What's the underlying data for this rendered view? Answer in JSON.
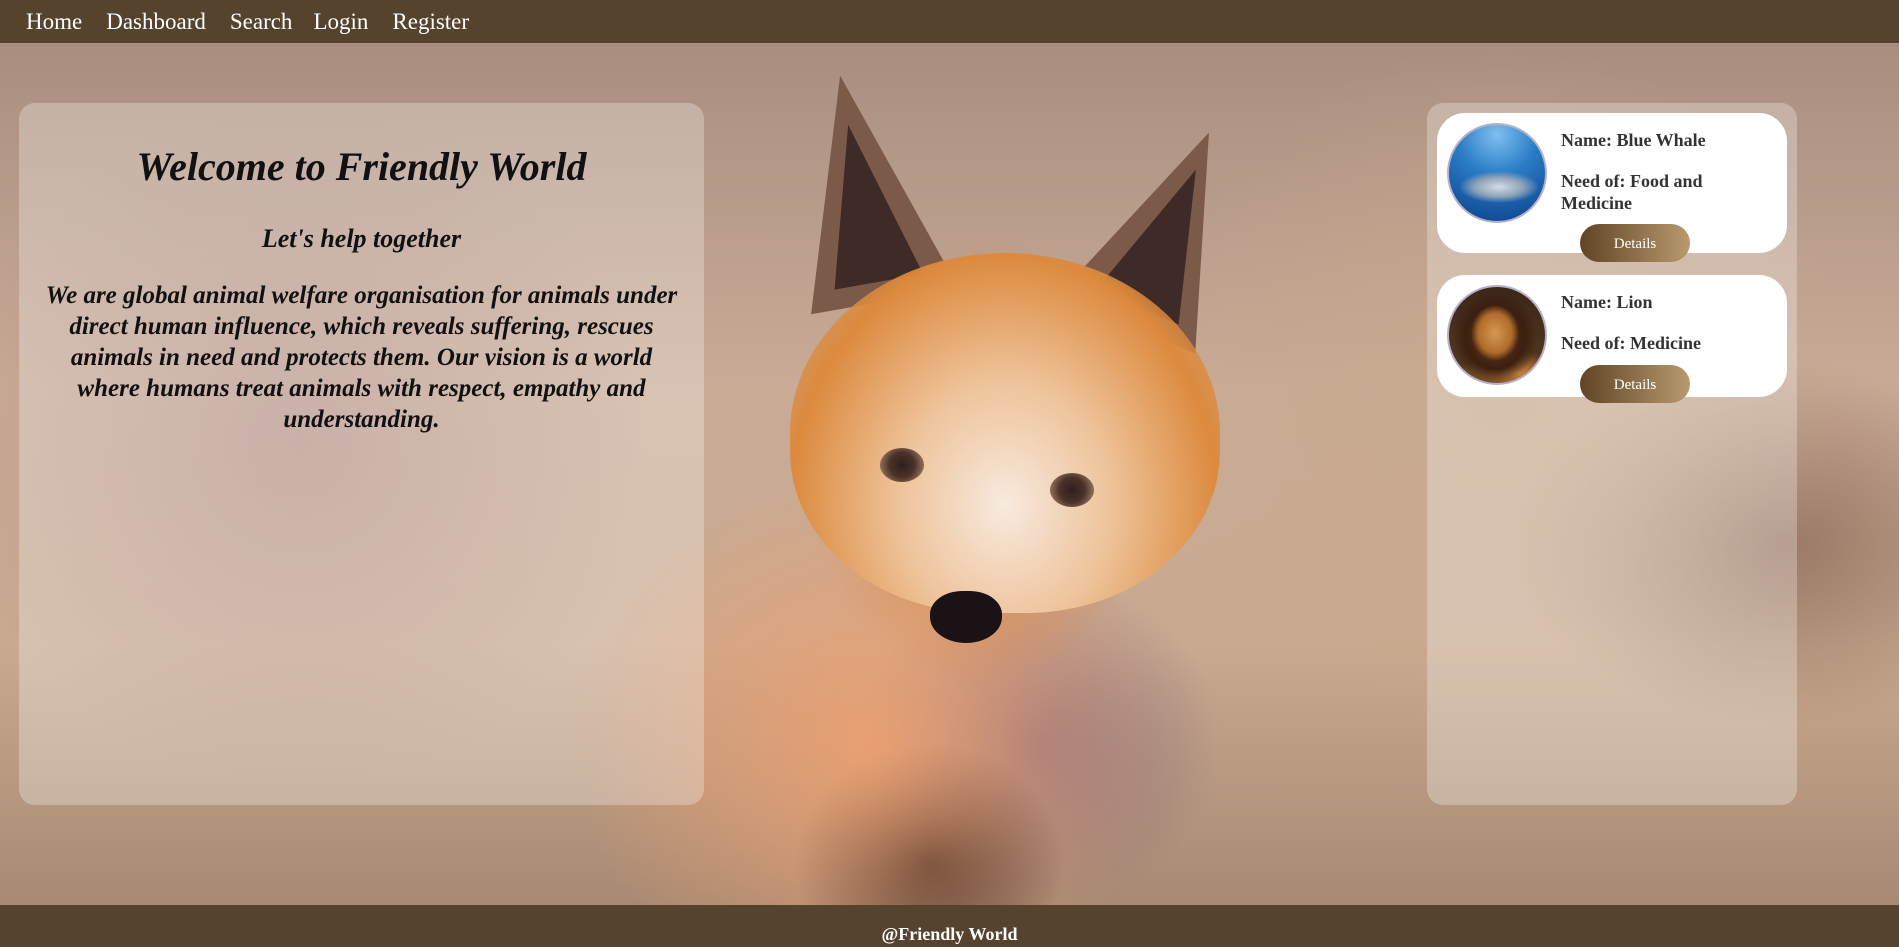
{
  "nav": {
    "items": [
      {
        "label": "Home"
      },
      {
        "label": "Dashboard"
      },
      {
        "label": "Search"
      },
      {
        "label": "Login"
      },
      {
        "label": "Register"
      }
    ]
  },
  "welcome": {
    "title": "Welcome to Friendly World",
    "subtitle": "Let's help together",
    "description": "We are global animal welfare organisation for animals under direct human influence, which reveals suffering, rescues animals in need and protects them. Our vision is a world where humans treat animals with respect, empathy and understanding."
  },
  "animals": [
    {
      "name": "Name: Blue Whale",
      "need": "Need of: Food and Medicine",
      "details_label": "Details",
      "image": "blue-whale-photo"
    },
    {
      "name": "Name: Lion",
      "need": "Need of: Medicine",
      "details_label": "Details",
      "image": "lion-photo"
    }
  ],
  "background": {
    "image": "fox-photo"
  },
  "colors": {
    "nav_bg": "#56432e",
    "footer_bg": "#56432e",
    "button_gradient_start": "#5f4526",
    "button_gradient_end": "#b99a6d"
  },
  "footer": {
    "text": "@Friendly World"
  }
}
